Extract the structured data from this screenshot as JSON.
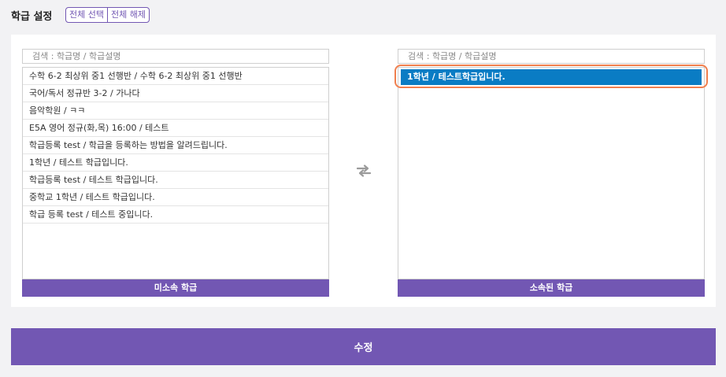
{
  "header": {
    "title": "학급 설정",
    "select_all_label": "전체 선택",
    "deselect_all_label": "전체 해제"
  },
  "left_list": {
    "search_placeholder": "검색 : 학급명 / 학급설명",
    "items": [
      "수학 6-2 최상위 중1 선행반 / 수학 6-2 최상위 중1 선행반",
      "국어/독서 정규반 3-2 / 가나다",
      "음악학원 / ㅋㅋ",
      "E5A 영어 정규(화,목) 16:00 / 테스트",
      "학급등록 test / 학급을 등록하는 방법을 알려드립니다.",
      "1학년 / 테스트 학급입니다.",
      "학급등록 test / 테스트 학급입니다.",
      "중학교 1학년 / 테스트 학급입니다.",
      "학급 등록 test / 테스트 중입니다."
    ],
    "footer_label": "미소속 학급"
  },
  "right_list": {
    "search_placeholder": "검색 : 학급명 / 학급설명",
    "items": [
      "1학년 / 테스트학급입니다."
    ],
    "footer_label": "소속된 학급"
  },
  "transfer_icon": "swap-arrows-icon",
  "submit_label": "수정",
  "colors": {
    "accent": "#7257b3",
    "selected": "#0a7cc4",
    "highlight_outline": "#f07f4e"
  }
}
